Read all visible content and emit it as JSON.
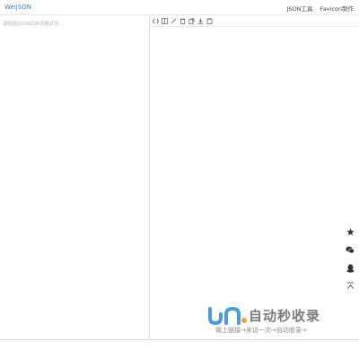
{
  "header": {
    "brand": "WeiJSON",
    "nav": [
      "JSON工具",
      "Favicon制作"
    ]
  },
  "editor": {
    "placeholder": "请粘贴JSON后自动格式化..."
  },
  "toolbar": {
    "icons": [
      "format-icon",
      "compress-icon",
      "escape-icon",
      "delete-icon",
      "copy-icon",
      "download-icon",
      "paste-icon"
    ]
  },
  "side_tools": {
    "icons": [
      "star-icon",
      "wechat-icon",
      "qq-icon",
      "back-to-top-icon"
    ]
  },
  "watermark": {
    "title": "自动秒收录",
    "subtitle": "做上链接→来访一次→自动收录→"
  },
  "colors": {
    "brand": "#3b7fc4",
    "watermark_logo": "#4a9be0"
  }
}
